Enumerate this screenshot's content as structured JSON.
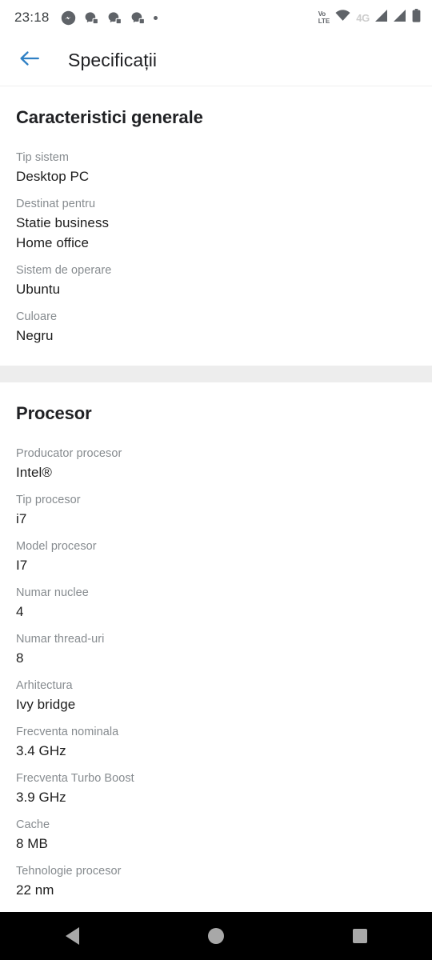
{
  "status_bar": {
    "time": "23:18",
    "left_icons": [
      "messenger-icon",
      "messenger-chat-icon",
      "messenger-chat-icon",
      "messenger-chat-icon",
      "dot-icon"
    ],
    "volte_top": "Vo",
    "volte_bottom": "LTE",
    "network": "4G",
    "right_icons": [
      "volte-icon",
      "wifi-icon",
      "network-4g-label",
      "signal-bars-icon",
      "signal-bars-icon",
      "battery-icon"
    ]
  },
  "app_bar": {
    "back_icon": "arrow-left-icon",
    "title": "Specificații",
    "accent_color": "#2f80c4"
  },
  "sections": [
    {
      "title": "Caracteristici generale",
      "rows": [
        {
          "label": "Tip sistem",
          "value": "Desktop PC"
        },
        {
          "label": "Destinat pentru",
          "value": "Statie business\nHome office"
        },
        {
          "label": "Sistem de operare",
          "value": "Ubuntu"
        },
        {
          "label": "Culoare",
          "value": "Negru"
        }
      ]
    },
    {
      "title": "Procesor",
      "rows": [
        {
          "label": "Producator procesor",
          "value": "Intel®"
        },
        {
          "label": "Tip procesor",
          "value": "i7"
        },
        {
          "label": "Model procesor",
          "value": "I7"
        },
        {
          "label": "Numar nuclee",
          "value": "4"
        },
        {
          "label": "Numar thread-uri",
          "value": "8"
        },
        {
          "label": "Arhitectura",
          "value": "Ivy bridge"
        },
        {
          "label": "Frecventa nominala",
          "value": "3.4 GHz"
        },
        {
          "label": "Frecventa Turbo Boost",
          "value": "3.9 GHz"
        },
        {
          "label": "Cache",
          "value": "8 MB"
        },
        {
          "label": "Tehnologie procesor",
          "value": "22 nm"
        }
      ]
    }
  ],
  "nav_bar": {
    "back": "nav-back-icon",
    "home": "nav-home-icon",
    "recents": "nav-recents-icon"
  }
}
